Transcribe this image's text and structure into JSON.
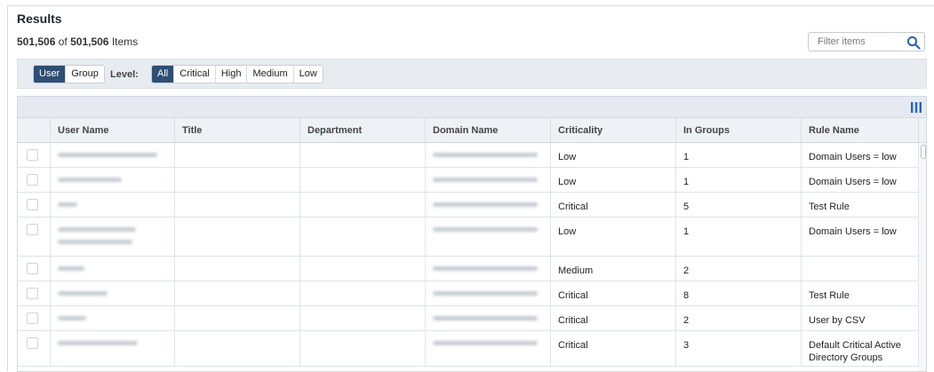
{
  "header": {
    "title": "Results",
    "count_shown": "501,506",
    "count_of": "of",
    "count_total": "501,506",
    "count_suffix": "Items"
  },
  "filter": {
    "placeholder": "Filter items",
    "icon": "search-icon"
  },
  "toolbar": {
    "type_options": [
      {
        "label": "User",
        "active": true
      },
      {
        "label": "Group",
        "active": false
      }
    ],
    "level_label": "Level:",
    "level_options": [
      {
        "label": "All",
        "active": true
      },
      {
        "label": "Critical",
        "active": false
      },
      {
        "label": "High",
        "active": false
      },
      {
        "label": "Medium",
        "active": false
      },
      {
        "label": "Low",
        "active": false
      }
    ]
  },
  "columns": [
    "User Name",
    "Title",
    "Department",
    "Domain Name",
    "Criticality",
    "In Groups",
    "Rule Name"
  ],
  "rows": [
    {
      "criticality": "Low",
      "in_groups": "1",
      "rule_name": "Domain Users = low"
    },
    {
      "criticality": "Low",
      "in_groups": "1",
      "rule_name": "Domain Users = low"
    },
    {
      "criticality": "Critical",
      "in_groups": "5",
      "rule_name": "Test Rule"
    },
    {
      "criticality": "Low",
      "in_groups": "1",
      "rule_name": "Domain Users = low"
    },
    {
      "criticality": "Medium",
      "in_groups": "2",
      "rule_name": ""
    },
    {
      "criticality": "Critical",
      "in_groups": "8",
      "rule_name": "Test Rule"
    },
    {
      "criticality": "Critical",
      "in_groups": "2",
      "rule_name": "User by CSV"
    },
    {
      "criticality": "Critical",
      "in_groups": "3",
      "rule_name": "Default Critical Active Directory Groups"
    }
  ],
  "colors": {
    "accent": "#2f4e74",
    "toolbar_bg": "#e8ecf1",
    "header_bg": "#eef2f6",
    "search_icon": "#2c63b8"
  }
}
